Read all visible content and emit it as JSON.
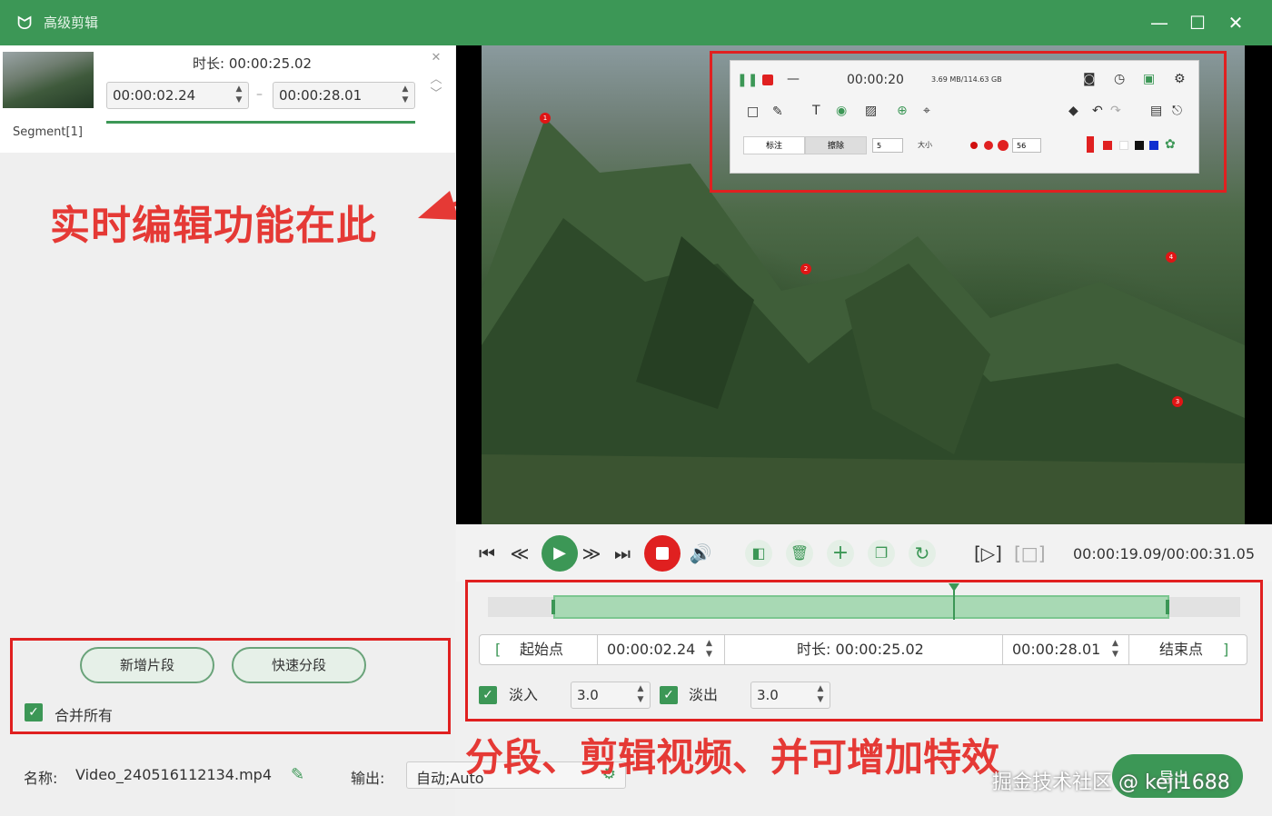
{
  "titlebar": {
    "title": "高级剪辑",
    "minimize": "—",
    "maximize": "☐",
    "close": "✕"
  },
  "segment": {
    "label": "Segment[1]",
    "duration_label": "时长:",
    "duration": "00:00:25.02",
    "start": "00:00:02.24",
    "end": "00:00:28.01",
    "dash": "–"
  },
  "annotations": {
    "left": "实时编辑功能在此",
    "bottom": "分段、剪辑视频、并可增加特效",
    "watermark": "掘金技术社区 @ keji1688"
  },
  "left_actions": {
    "add_segment": "新增片段",
    "quick_split": "快速分段",
    "merge_all": "合并所有"
  },
  "footer": {
    "name_label": "名称:",
    "file_name": "Video_240516112134.mp4",
    "output_label": "输出:",
    "output_value": "自动;Auto",
    "export_label": "导出"
  },
  "mini_toolbar": {
    "time": "00:00:20",
    "size": "3.69 MB/114.63 GB",
    "btn1": "标注",
    "btn2": "擦除",
    "size_label": "大小",
    "num": "56",
    "opacity": "5"
  },
  "video_markers": [
    "1",
    "2",
    "3",
    "4"
  ],
  "controls": {
    "time_readout": "00:00:19.09/00:00:31.05"
  },
  "trim": {
    "start_label": "起始点",
    "start": "00:00:02.24",
    "duration_label": "时长:",
    "duration": "00:00:25.02",
    "end": "00:00:28.01",
    "end_label": "结束点",
    "fade_in_label": "淡入",
    "fade_in": "3.0",
    "fade_out_label": "淡出",
    "fade_out": "3.0"
  },
  "colors": {
    "brand": "#3c9756",
    "annotation_red": "#e02020"
  }
}
